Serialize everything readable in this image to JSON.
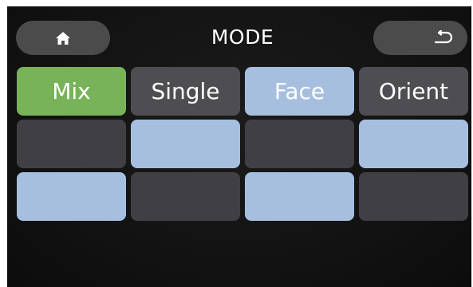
{
  "header": {
    "title": "MODE",
    "home_icon": "home-icon",
    "back_icon": "return-arrow-icon"
  },
  "mode_buttons": [
    {
      "label": "Mix",
      "selected": true
    },
    {
      "label": "Single",
      "selected": false
    },
    {
      "label": "Face",
      "selected": false
    },
    {
      "label": "Orient",
      "selected": false
    }
  ],
  "colors": {
    "selected": "#78b35a",
    "button_gray": "#4e4e52",
    "button_blue": "#a7bfdf",
    "button_dark": "#404044",
    "pill": "#4b4b4b",
    "background": "#111111"
  }
}
